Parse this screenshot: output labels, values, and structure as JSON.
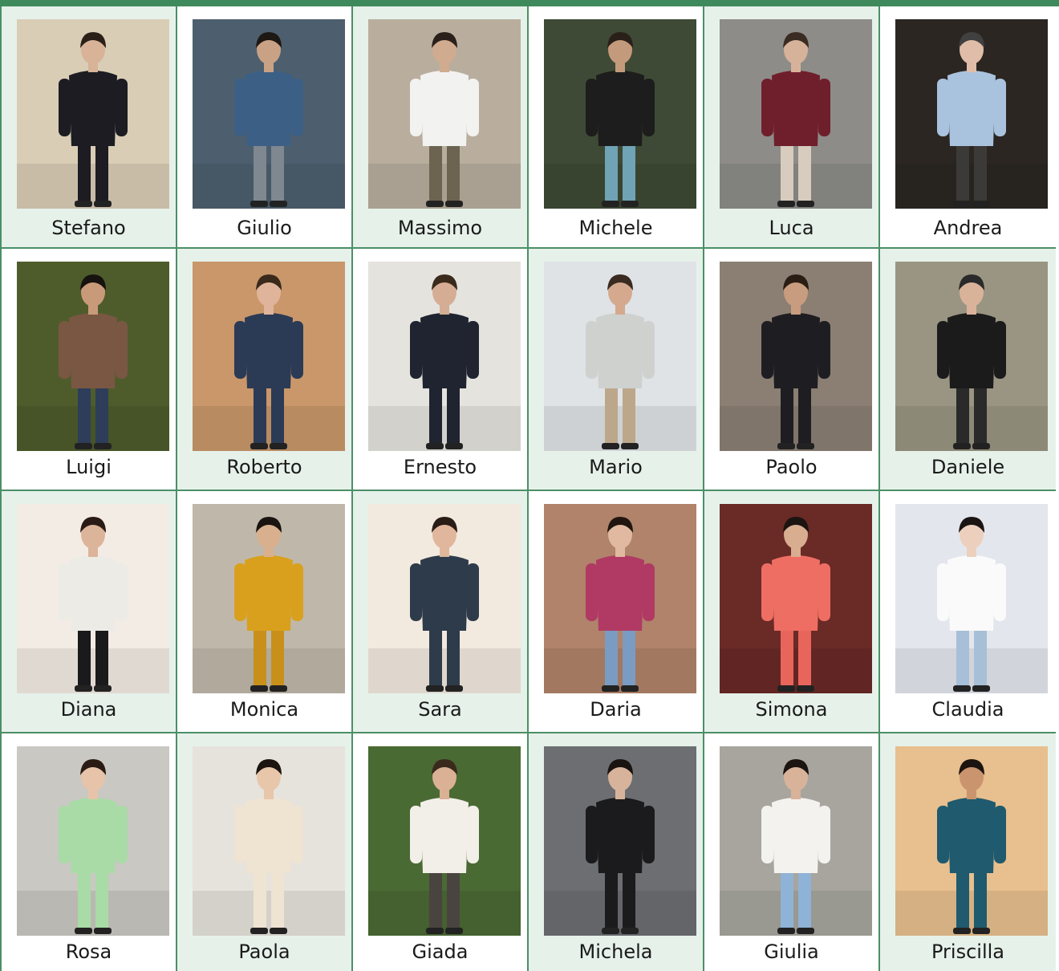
{
  "people": [
    {
      "name": "Stefano",
      "bg": "#d9cdb6",
      "top": "#1c1c22",
      "bottom": "#1c1c22",
      "skin": "#d8b398",
      "hair": "#2a2018"
    },
    {
      "name": "Giulio",
      "bg": "#4d5f6e",
      "top": "#3c5f86",
      "bottom": "#7f8790",
      "skin": "#c9a184",
      "hair": "#1e1814"
    },
    {
      "name": "Massimo",
      "bg": "#b9ae9e",
      "top": "#f2f2f0",
      "bottom": "#6c6450",
      "skin": "#d0ab8f",
      "hair": "#2b211a"
    },
    {
      "name": "Michele",
      "bg": "#3e4a35",
      "top": "#1d1d1d",
      "bottom": "#6fa3b5",
      "skin": "#c39a7b",
      "hair": "#2a2019"
    },
    {
      "name": "Luca",
      "bg": "#8d8c88",
      "top": "#6f1f2b",
      "bottom": "#d7ccbd",
      "skin": "#d7b29a",
      "hair": "#3a2c22"
    },
    {
      "name": "Andrea",
      "bg": "#2b2622",
      "top": "#a9c3de",
      "bottom": "#3c3a38",
      "skin": "#e0bda8",
      "hair": "#404040"
    },
    {
      "name": "Luigi",
      "bg": "#4e5c2c",
      "top": "#7a5742",
      "bottom": "#2d3d5a",
      "skin": "#c89a7a",
      "hair": "#17120f"
    },
    {
      "name": "Roberto",
      "bg": "#c9976a",
      "top": "#2b3a55",
      "bottom": "#2b3a55",
      "skin": "#e0b49a",
      "hair": "#3a2a1c"
    },
    {
      "name": "Ernesto",
      "bg": "#e4e3de",
      "top": "#1f2430",
      "bottom": "#1f2430",
      "skin": "#d5ad94",
      "hair": "#3a2a1c"
    },
    {
      "name": "Mario",
      "bg": "#dfe3e6",
      "top": "#cfd1cf",
      "bottom": "#bda78b",
      "skin": "#d4a98d",
      "hair": "#3a2a20"
    },
    {
      "name": "Paolo",
      "bg": "#8b7f73",
      "top": "#1e1e22",
      "bottom": "#1e1e22",
      "skin": "#c89c7e",
      "hair": "#2a1d14"
    },
    {
      "name": "Daniele",
      "bg": "#9a9582",
      "top": "#1b1b1b",
      "bottom": "#2a2a2a",
      "skin": "#d8b39a",
      "hair": "#2a2a2a"
    },
    {
      "name": "Diana",
      "bg": "#f3ece4",
      "top": "#ecebe6",
      "bottom": "#1a1a1c",
      "skin": "#dcb49a",
      "hair": "#2a1c14"
    },
    {
      "name": "Monica",
      "bg": "#bfb8aa",
      "top": "#d9a01e",
      "bottom": "#c8901a",
      "skin": "#d8b08e",
      "hair": "#1a1410"
    },
    {
      "name": "Sara",
      "bg": "#f2eadf",
      "top": "#2e3b4a",
      "bottom": "#2e3b4a",
      "skin": "#e0b79c",
      "hair": "#2a1c16"
    },
    {
      "name": "Daria",
      "bg": "#b0836a",
      "top": "#b03a64",
      "bottom": "#7a9cc2",
      "skin": "#e0b9a0",
      "hair": "#20160f"
    },
    {
      "name": "Simona",
      "bg": "#6a2a26",
      "top": "#ee6e63",
      "bottom": "#e8655c",
      "skin": "#d8ad90",
      "hair": "#1c1410"
    },
    {
      "name": "Claudia",
      "bg": "#e4e6ee",
      "top": "#fafafa",
      "bottom": "#a8bfd8",
      "skin": "#ecd0bd",
      "hair": "#1a1412"
    },
    {
      "name": "Rosa",
      "bg": "#c9c8c2",
      "top": "#a9dba6",
      "bottom": "#a9dba6",
      "skin": "#e6c3a9",
      "hair": "#2a1c14"
    },
    {
      "name": "Paola",
      "bg": "#e6e3dc",
      "top": "#efe3d2",
      "bottom": "#efe3d2",
      "skin": "#e8c6aa",
      "hair": "#1c1410"
    },
    {
      "name": "Giada",
      "bg": "#4a6a34",
      "top": "#f2efe8",
      "bottom": "#4a4440",
      "skin": "#dab194",
      "hair": "#3a2a1c"
    },
    {
      "name": "Michela",
      "bg": "#6c6e72",
      "top": "#1b1b1d",
      "bottom": "#1b1b1d",
      "skin": "#d8b39c",
      "hair": "#1a1410"
    },
    {
      "name": "Giulia",
      "bg": "#a7a59e",
      "top": "#f4f2ee",
      "bottom": "#8fb3d6",
      "skin": "#d8b39a",
      "hair": "#1c1410"
    },
    {
      "name": "Priscilla",
      "bg": "#e8bf8e",
      "top": "#1f5a6e",
      "bottom": "#1f5a6e",
      "skin": "#c9946e",
      "hair": "#1c1410"
    }
  ]
}
